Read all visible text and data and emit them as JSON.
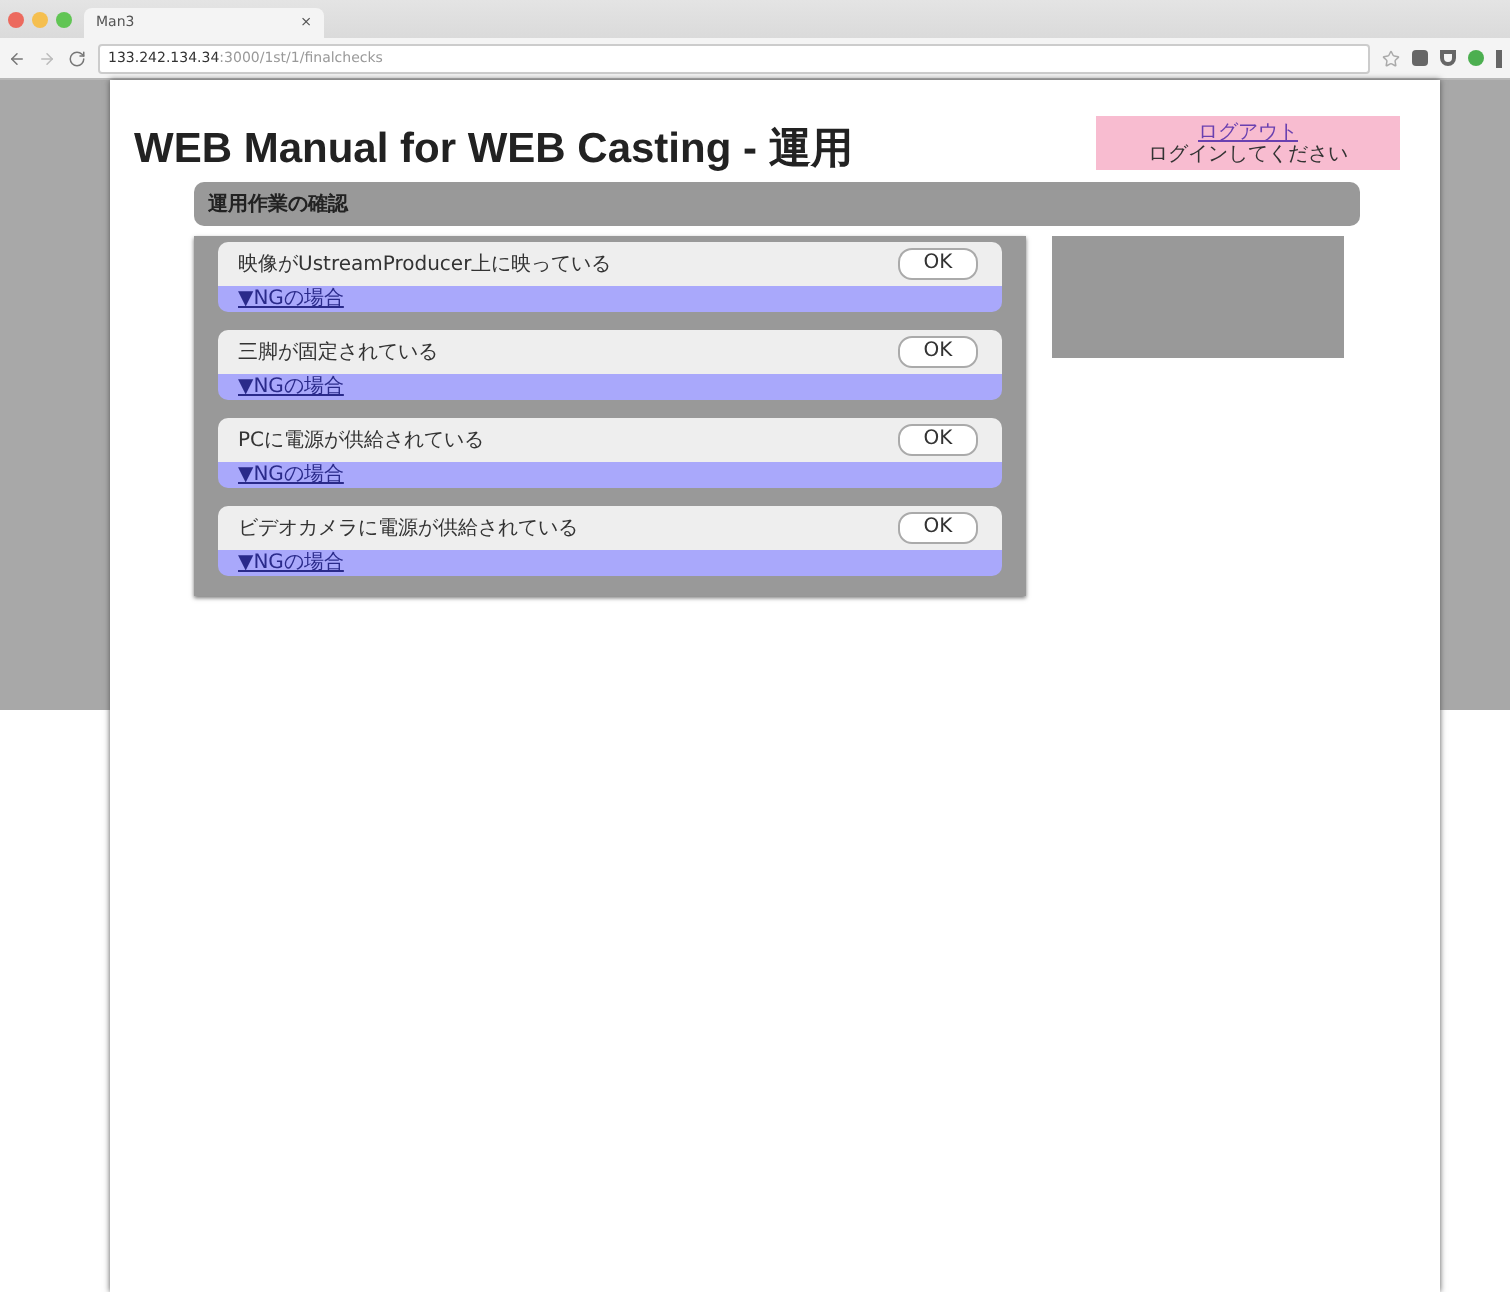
{
  "browser": {
    "tab_title": "Man3",
    "tab_close": "×",
    "url_host": "133.242.134.34",
    "url_path": ":3000/1st/1/finalchecks"
  },
  "header": {
    "title": "WEB Manual for WEB Casting - 運用",
    "logout_link": "ログアウト",
    "login_prompt": "ログインしてください"
  },
  "section": {
    "title": "運用作業の確認"
  },
  "checks": [
    {
      "label": "映像がUstreamProducer上に映っている",
      "button": "OK",
      "ng_link": "▼NGの場合"
    },
    {
      "label": "三脚が固定されている",
      "button": "OK",
      "ng_link": "▼NGの場合"
    },
    {
      "label": "PCに電源が供給されている",
      "button": "OK",
      "ng_link": "▼NGの場合"
    },
    {
      "label": "ビデオカメラに電源が供給されている",
      "button": "OK",
      "ng_link": "▼NGの場合"
    }
  ]
}
